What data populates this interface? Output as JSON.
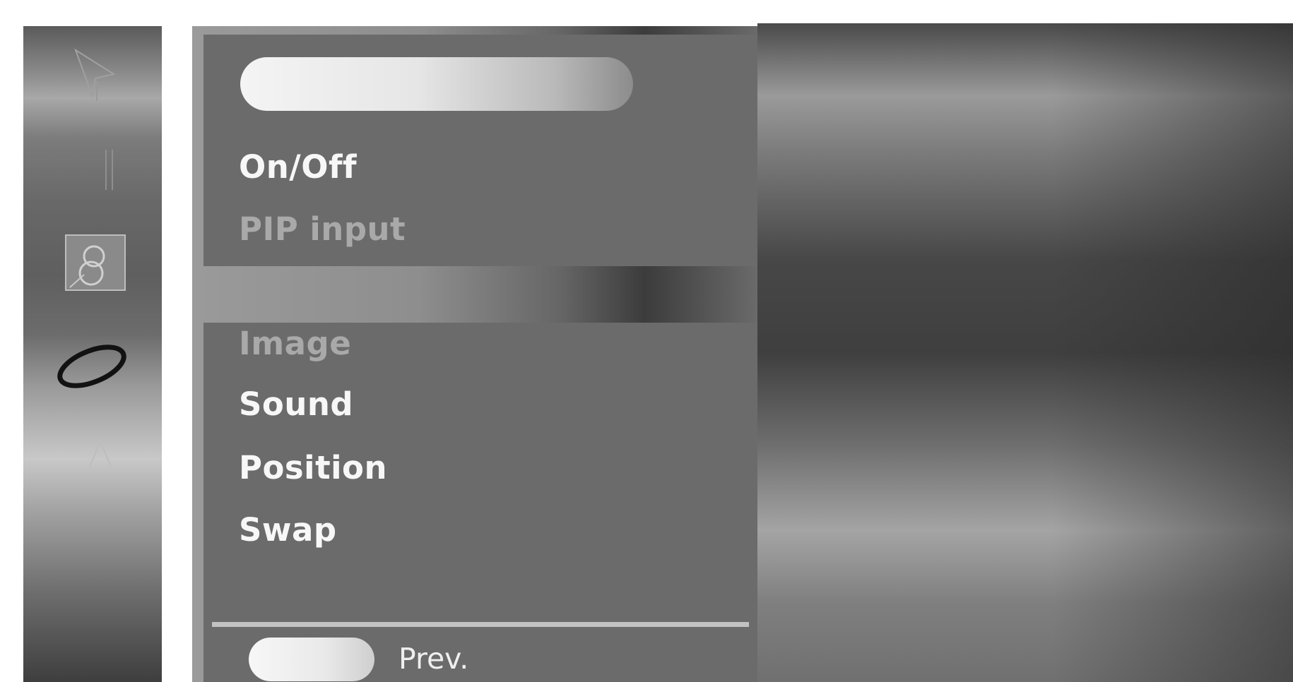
{
  "menu": {
    "title_pill": "",
    "top_items": [
      {
        "label": "On/Off",
        "state": "active"
      },
      {
        "label": "PIP input",
        "state": "disabled"
      }
    ],
    "bottom_items": [
      {
        "label": "Image",
        "state": "disabled"
      },
      {
        "label": "Sound",
        "state": "active"
      },
      {
        "label": "Position",
        "state": "active"
      },
      {
        "label": "Swap",
        "state": "active"
      }
    ]
  },
  "footer": {
    "prev_label": "Prev."
  },
  "icons": [
    "picture-icon",
    "sound-icon",
    "setup-icon",
    "disc-icon",
    "lock-icon"
  ],
  "colors": {
    "panel": "#6b6b6b",
    "active_text": "#f7f7f7",
    "disabled_text": "#a9a9a9"
  }
}
